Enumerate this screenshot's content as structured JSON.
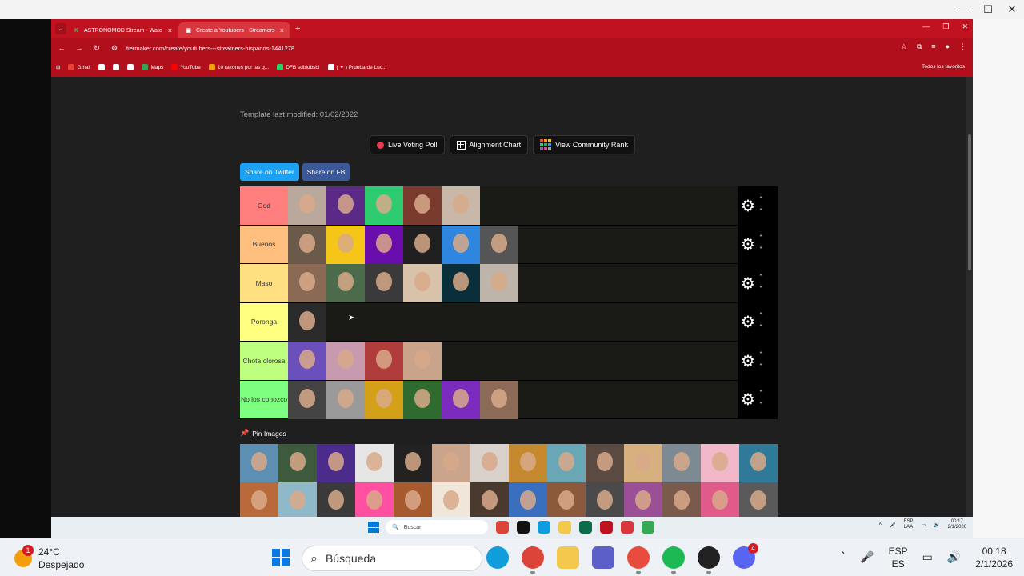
{
  "browser": {
    "tabs": [
      {
        "title": "ASTRONOMOD Stream - Watc",
        "active": false
      },
      {
        "title": "Create a Youtubers - Streamers",
        "active": true
      }
    ],
    "url": "tiermaker.com/create/youtubers---streamers-hispanos-1441278",
    "bookmarks": [
      "Gmail",
      "Maps",
      "YouTube",
      "10 razones por las q...",
      "DFB sdbidbsbi",
      "( ✦ ) Prueba de Luc..."
    ],
    "bookmarks_right": "Todos los favoritos"
  },
  "page": {
    "modified": "Template last modified: 01/02/2022",
    "actions": [
      "Live Voting Poll",
      "Alignment Chart",
      "View Community Rank"
    ],
    "share_twitter": "Share on Twitter",
    "share_fb": "Share on FB",
    "pin_title": "Pin Images"
  },
  "tiers": [
    {
      "label": "God",
      "color": "#ff7f7f",
      "items": [
        "#b9a89b",
        "#5b2a86",
        "#2ecc71",
        "#7a3b2e",
        "#c9b8a8"
      ]
    },
    {
      "label": "Buenos",
      "color": "#ffbf7f",
      "items": [
        "#6b5a4a",
        "#f5c518",
        "#6a0dad",
        "#202020",
        "#2e86de",
        "#555555"
      ]
    },
    {
      "label": "Maso",
      "color": "#ffdf7f",
      "items": [
        "#8a6a55",
        "#4b6b4a",
        "#3a3a3a",
        "#d9c2aa",
        "#0b2f3a",
        "#bfb4aa"
      ]
    },
    {
      "label": "Poronga",
      "color": "#ffff7f",
      "items": [
        "#2a2a2a"
      ]
    },
    {
      "label": "Chota olorosa",
      "color": "#bfff7f",
      "items": [
        "#6b4fbb",
        "#c89ab0",
        "#b03c3c",
        "#c9a48a"
      ]
    },
    {
      "label": "No los conozco",
      "color": "#7fff7f",
      "items": [
        "#444444",
        "#9a9a9a",
        "#d4a017",
        "#2f6b2f",
        "#7b2cbf",
        "#8c6a58"
      ]
    }
  ],
  "pool": [
    "#5d8fb3",
    "#3d5a3d",
    "#4b2b8c",
    "#e6e6e6",
    "#222222",
    "#caa48c",
    "#d9d2cc",
    "#c68a2e",
    "#6aa7b6",
    "#5a4a42",
    "#d6b07e",
    "#7d8a94",
    "#f0b8c8",
    "#2f7a99",
    "#b96a3a",
    "#8fb8c9",
    "#3a3a3a",
    "#ff4fa0",
    "#a65a2e",
    "#f0e6da",
    "#4a3a2e",
    "#3a6fbf",
    "#8b5a3c",
    "#4a4a4a",
    "#9b4f96",
    "#7a5a4a",
    "#e05a8a",
    "#5a5a5a",
    "#1ec0f0",
    "#aaaaaa",
    "#6b3a8a",
    "#c03030",
    "#3aa05a",
    "#d06a9a",
    "#c9c9c9",
    "#2a2a2a",
    "#e0c040",
    "#777777",
    "#b5a090",
    "#d08a5a",
    "#b07a8a",
    "#4a5a6a"
  ],
  "vm_taskbar": {
    "search": "Buscar",
    "lang": [
      "ESP",
      "LAA"
    ],
    "clock": [
      "00:17",
      "2/1/2026"
    ]
  },
  "host_taskbar": {
    "badge": "1",
    "temp": "24°C",
    "weather": "Despejado",
    "search": "Búsqueda",
    "lang": [
      "ESP",
      "ES"
    ],
    "clock": [
      "00:18",
      "2/1/2026"
    ],
    "discord_badge": "4"
  }
}
